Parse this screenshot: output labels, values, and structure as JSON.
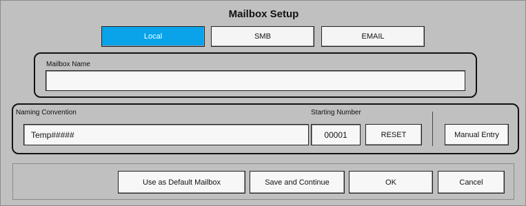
{
  "window": {
    "title": "Mailbox Setup"
  },
  "tabs": [
    {
      "label": "Local",
      "active": true
    },
    {
      "label": "SMB",
      "active": false
    },
    {
      "label": "EMAIL",
      "active": false
    }
  ],
  "mailbox": {
    "name_label": "Mailbox Name",
    "name_value": ""
  },
  "naming": {
    "convention_label": "Naming Convention",
    "convention_value": "Temp#####",
    "starting_label": "Starting Number",
    "starting_value": "00001",
    "reset_label": "RESET",
    "manual_entry_label": "Manual Entry"
  },
  "actions": {
    "default_label": "Use as Default Mailbox",
    "save_continue_label": "Save and Continue",
    "ok_label": "OK",
    "cancel_label": "Cancel"
  },
  "colors": {
    "active_tab": "#0aa2e8",
    "background": "#c0c0c0"
  }
}
